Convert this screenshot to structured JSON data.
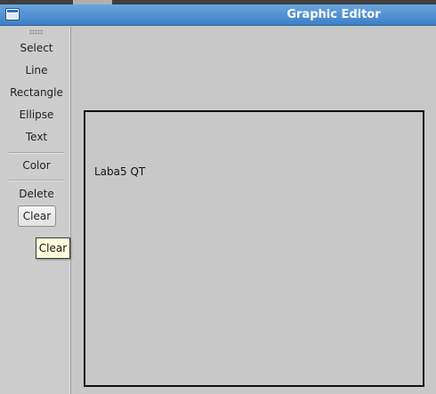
{
  "window": {
    "title": "Graphic Editor"
  },
  "toolbar": {
    "tools": [
      "Select",
      "Line",
      "Rectangle",
      "Ellipse",
      "Text"
    ],
    "color_label": "Color",
    "delete_label": "Delete",
    "clear_label": "Clear"
  },
  "tooltip": {
    "text": "Clear"
  },
  "canvas": {
    "scene_text": "Laba5 QT"
  },
  "colors": {
    "titlebar": "#4f8fd2",
    "background": "#c8c8c8",
    "tooltip_bg": "#ffffdc",
    "frame_border": "#111111"
  }
}
